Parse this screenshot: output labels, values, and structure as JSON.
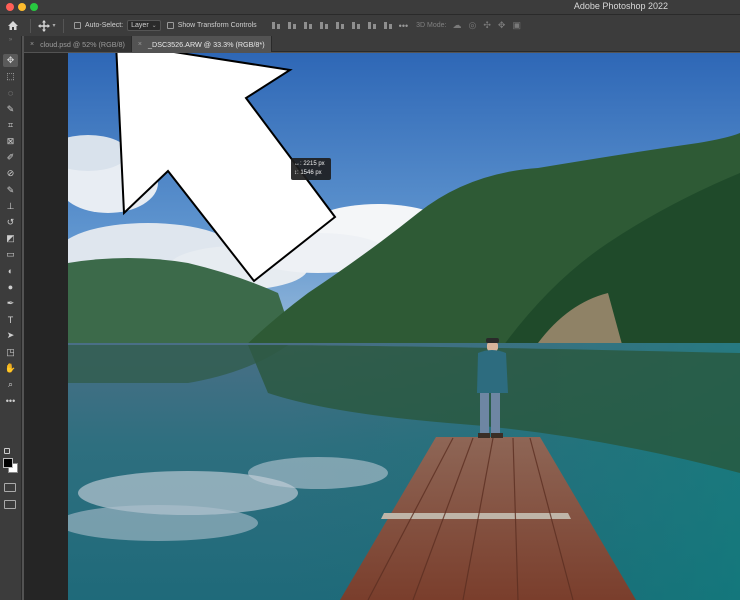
{
  "window": {
    "title": "Adobe Photoshop 2022"
  },
  "options_bar": {
    "auto_select_label": "Auto-Select:",
    "auto_select_value": "Layer",
    "transform_label": "Show Transform Controls",
    "more": "•••",
    "mode_3d": "3D Mode:"
  },
  "tabs": [
    {
      "title": "cloud.psd @ 52% (RGB/8)",
      "close": "×",
      "active": false
    },
    {
      "title": "_DSC3526.ARW @ 33.3% (RGB/8*)",
      "close": "×",
      "active": true
    }
  ],
  "measure_tooltip": {
    "width": "↔: 2215 px",
    "height": "↕: 1546 px"
  },
  "toolbar": {
    "grip": "»",
    "tools": [
      {
        "name": "move-tool",
        "icon": "move-icon",
        "active": true
      },
      {
        "name": "marquee-tool",
        "icon": "rectangle-marquee-icon"
      },
      {
        "name": "lasso-tool",
        "icon": "lasso-icon"
      },
      {
        "name": "quick-select-tool",
        "icon": "quick-select-icon"
      },
      {
        "name": "crop-tool",
        "icon": "crop-icon"
      },
      {
        "name": "frame-tool",
        "icon": "frame-icon"
      },
      {
        "name": "eyedropper-tool",
        "icon": "eyedropper-icon"
      },
      {
        "name": "healing-tool",
        "icon": "bandage-icon"
      },
      {
        "name": "brush-tool",
        "icon": "brush-icon"
      },
      {
        "name": "stamp-tool",
        "icon": "stamp-icon"
      },
      {
        "name": "history-brush-tool",
        "icon": "history-brush-icon"
      },
      {
        "name": "eraser-tool",
        "icon": "eraser-icon"
      },
      {
        "name": "gradient-tool",
        "icon": "gradient-icon"
      },
      {
        "name": "blur-tool",
        "icon": "blur-icon"
      },
      {
        "name": "dodge-tool",
        "icon": "dodge-icon"
      },
      {
        "name": "pen-tool",
        "icon": "pen-icon"
      },
      {
        "name": "type-tool",
        "icon": "type-icon",
        "glyph": "T"
      },
      {
        "name": "path-select-tool",
        "icon": "arrow-icon"
      },
      {
        "name": "shape-tool",
        "icon": "shape-icon"
      },
      {
        "name": "hand-tool",
        "icon": "hand-icon"
      },
      {
        "name": "zoom-tool",
        "icon": "zoom-icon"
      }
    ],
    "edit_toolbar": "•••"
  },
  "colors": {
    "foreground": "#000000",
    "background": "#ffffff"
  }
}
